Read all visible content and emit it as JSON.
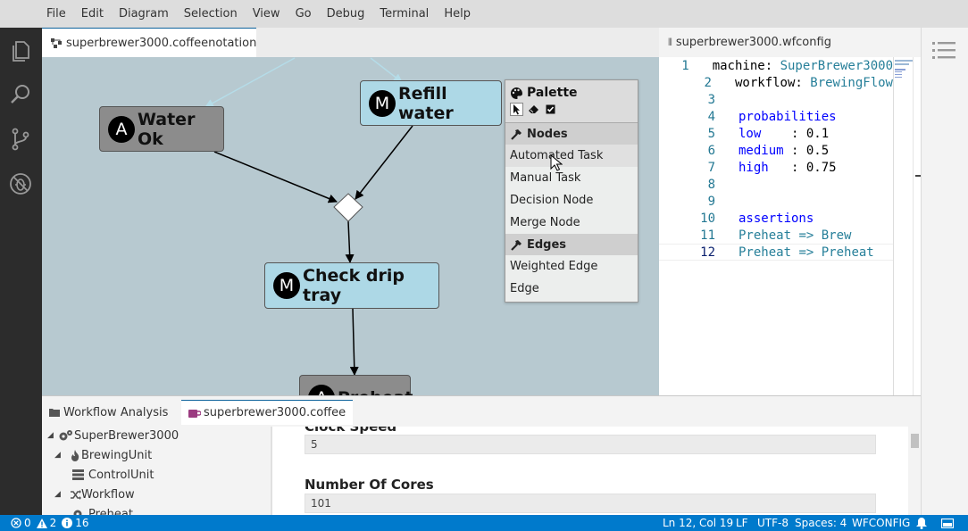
{
  "menu": [
    "File",
    "Edit",
    "Diagram",
    "Selection",
    "View",
    "Go",
    "Debug",
    "Terminal",
    "Help"
  ],
  "editor_tabs": {
    "left": "superbrewer3000.coffeenotation",
    "right": "superbrewer3000.wfconfig"
  },
  "diagram": {
    "nodes": [
      {
        "badge": "M",
        "label": "Refill water",
        "kind": "manual"
      },
      {
        "badge": "A",
        "label": "Water Ok",
        "kind": "automated"
      },
      {
        "badge": "M",
        "label": "Check drip tray",
        "kind": "manual"
      },
      {
        "badge": "A",
        "label": "Preheat",
        "kind": "automated"
      }
    ]
  },
  "palette": {
    "title": "Palette",
    "groups": [
      {
        "name": "Nodes",
        "items": [
          "Automated Task",
          "Manual Task",
          "Decision Node",
          "Merge Node"
        ]
      },
      {
        "name": "Edges",
        "items": [
          "Weighted Edge",
          "Edge"
        ]
      }
    ]
  },
  "code": {
    "line_numbers": [
      "1",
      "2",
      "3",
      "4",
      "5",
      "6",
      "7",
      "8",
      "9",
      "10",
      "11",
      "12"
    ],
    "lines": [
      {
        "k": "machine:",
        "v": " SuperBrewer3000"
      },
      {
        "k": "workflow:",
        "v": " BrewingFlow"
      },
      {
        "k": "",
        "v": ""
      },
      {
        "k": "probabilities",
        "v": ""
      },
      {
        "k": "low",
        "v": "    : 0.1"
      },
      {
        "k": "medium",
        "v": " : 0.5"
      },
      {
        "k": "high",
        "v": "   : 0.75"
      },
      {
        "k": "",
        "v": ""
      },
      {
        "k": "",
        "v": ""
      },
      {
        "k": "assertions",
        "v": ""
      },
      {
        "k": "Preheat",
        "v": " => Brew"
      },
      {
        "k": "Preheat",
        "v": " => Preheat"
      }
    ]
  },
  "bottom_tabs": [
    "Workflow Analysis",
    "superbrewer3000.coffee"
  ],
  "tree": [
    {
      "label": "SuperBrewer3000",
      "icon": "gears-icon",
      "level": 0
    },
    {
      "label": "BrewingUnit",
      "icon": "flame-icon",
      "level": 1
    },
    {
      "label": "ControlUnit",
      "icon": "server-icon",
      "level": 2
    },
    {
      "label": "Workflow",
      "icon": "shuffle-icon",
      "level": 1
    },
    {
      "label": "Preheat",
      "icon": "gear-icon",
      "level": 2
    }
  ],
  "properties": [
    {
      "label": "Clock Speed",
      "value": "5"
    },
    {
      "label": "Number Of Cores",
      "value": "101"
    }
  ],
  "status": {
    "errors": "0",
    "warnings": "2",
    "infos": "16",
    "position": "Ln 12, Col 19",
    "eol": "LF",
    "encoding": "UTF-8",
    "indent": "Spaces: 4",
    "language": "WFCONFIG"
  }
}
